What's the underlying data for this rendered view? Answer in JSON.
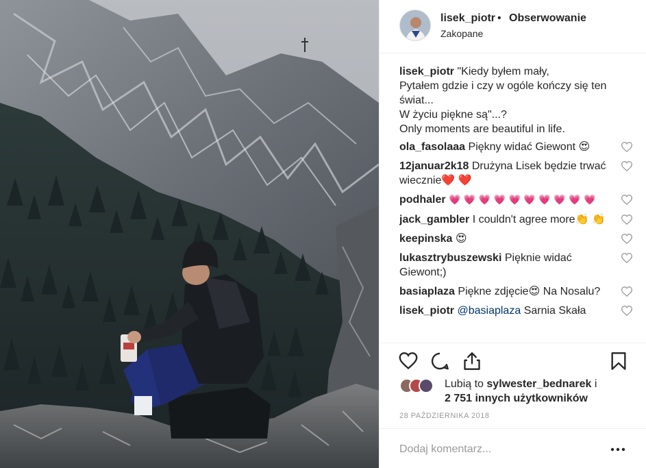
{
  "header": {
    "username": "lisek_piotr",
    "separator": "•",
    "follow_status": "Obserwowanie",
    "location": "Zakopane"
  },
  "comments": [
    {
      "user": "lisek_piotr",
      "text": "\"Kiedy byłem mały,",
      "lines": [
        "Pytałem gdzie i czy w ogóle kończy się ten",
        "świat...",
        "W życiu piękne są\"...?",
        "Only moments are beautiful in life."
      ]
    },
    {
      "user": "ola_fasolaaa",
      "text": "Piękny widać Giewont 😍"
    },
    {
      "user": "12januar2k18",
      "text": "Drużyna Lisek będzie trwać wiecznie❤️ ❤️"
    },
    {
      "user": "podhaler",
      "text": "💗 💗 💗 💗 💗 💗 💗 💗 💗 💗"
    },
    {
      "user": "jack_gambler",
      "text": "I couldn't agree more👏 👏"
    },
    {
      "user": "keepinska",
      "text": "😍"
    },
    {
      "user": "lukasztrybuszewski",
      "text": "Pięknie widać Giewont;)"
    },
    {
      "user": "basiaplaza",
      "text": "Piękne zdjęcie😍 Na Nosalu?"
    },
    {
      "user": "lisek_piotr",
      "mention": "@basiaplaza",
      "text": "Sarnia Skała"
    }
  ],
  "likes": {
    "prefix": "Lubią to",
    "user": "sylwester_bednarek",
    "joiner": "i",
    "others": "2 751 innych użytkowników"
  },
  "date": "28 PAŹDZIERNIKA 2018",
  "add_comment": {
    "placeholder": "Dodaj komentarz..."
  },
  "colors": {
    "text": "#262626",
    "muted": "#999999",
    "border": "#efefef",
    "mention": "#003569"
  },
  "icons": [
    "heart-icon",
    "comment-icon",
    "share-icon",
    "bookmark-icon",
    "more-icon"
  ]
}
